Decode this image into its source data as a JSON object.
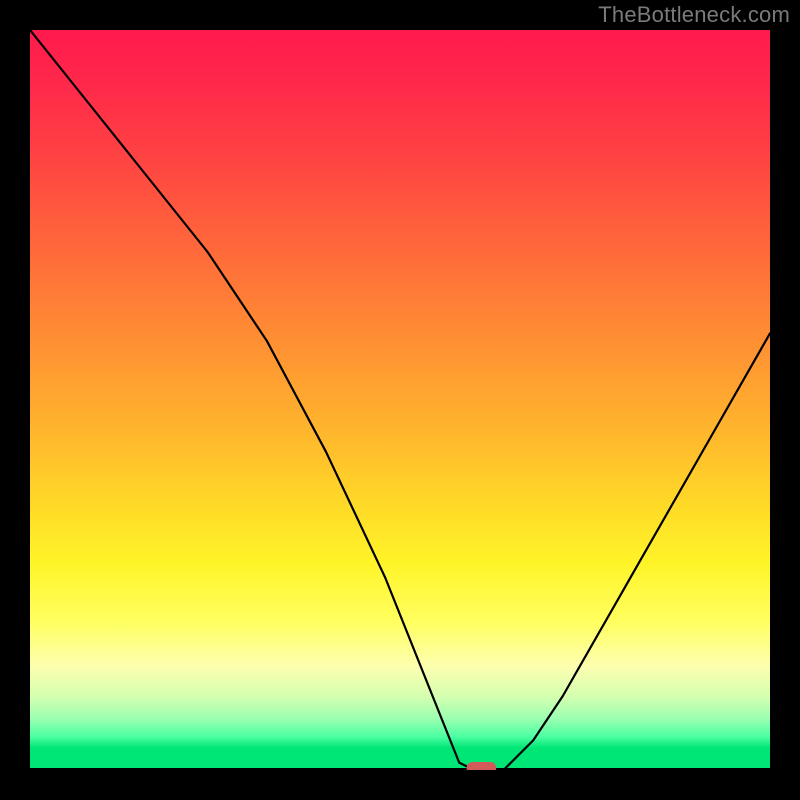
{
  "watermark": "TheBottleneck.com",
  "colors": {
    "background": "#000000",
    "watermark_text": "#7a7a7a",
    "curve": "#000000",
    "marker": "#d45a5a",
    "gradient_stops": [
      "#ff1a4d",
      "#ff2a4a",
      "#ff4542",
      "#ff6a3a",
      "#ff8f33",
      "#ffb52d",
      "#ffd927",
      "#fff428",
      "#ffff60",
      "#fdffb0",
      "#d5ffb0",
      "#9dffb1",
      "#4bffa2",
      "#00e676"
    ]
  },
  "chart_data": {
    "type": "line",
    "title": "",
    "xlabel": "",
    "ylabel": "",
    "xlim": [
      0,
      100
    ],
    "ylim": [
      0,
      100
    ],
    "grid": false,
    "legend": false,
    "x": [
      0,
      8,
      16,
      24,
      32,
      40,
      48,
      56,
      58,
      60,
      62,
      64,
      68,
      72,
      76,
      80,
      84,
      88,
      92,
      96,
      100
    ],
    "values": [
      100,
      90,
      80,
      70,
      58,
      43,
      26,
      6,
      1,
      0,
      0,
      0,
      4,
      10,
      17,
      24,
      31,
      38,
      45,
      52,
      59
    ],
    "marker": {
      "x_center": 61,
      "y": 0,
      "width": 4
    }
  }
}
